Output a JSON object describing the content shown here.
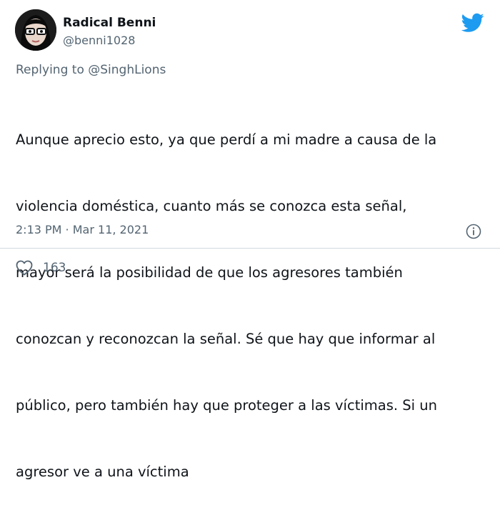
{
  "tweet": {
    "author_name": "Radical Benni",
    "author_handle": "@benni1028",
    "reply_prefix": "Replying to ",
    "reply_to": "@SinghLions",
    "lines": [
      "Aunque aprecio esto, ya que perdí a mi madre a causa de la",
      "violencia doméstica, cuanto más se conozca esta señal,",
      "mayor será la posibilidad de que los agresores también",
      "conozcan y reconozcan la señal. Sé que hay que informar al",
      "público, pero también hay que proteger a las víctimas. Si un",
      "agresor ve a una víctima"
    ],
    "time": "2:13 PM",
    "separator": " · ",
    "date": "Mar 11, 2021",
    "like_count": "163"
  },
  "icons": {
    "brand": "twitter-bird-icon",
    "info": "info-icon",
    "like": "heart-icon"
  },
  "colors": {
    "brand_blue": "#1d9bf0",
    "text_primary": "#0f1419",
    "text_secondary": "#536471",
    "divider": "#cfd9de"
  }
}
